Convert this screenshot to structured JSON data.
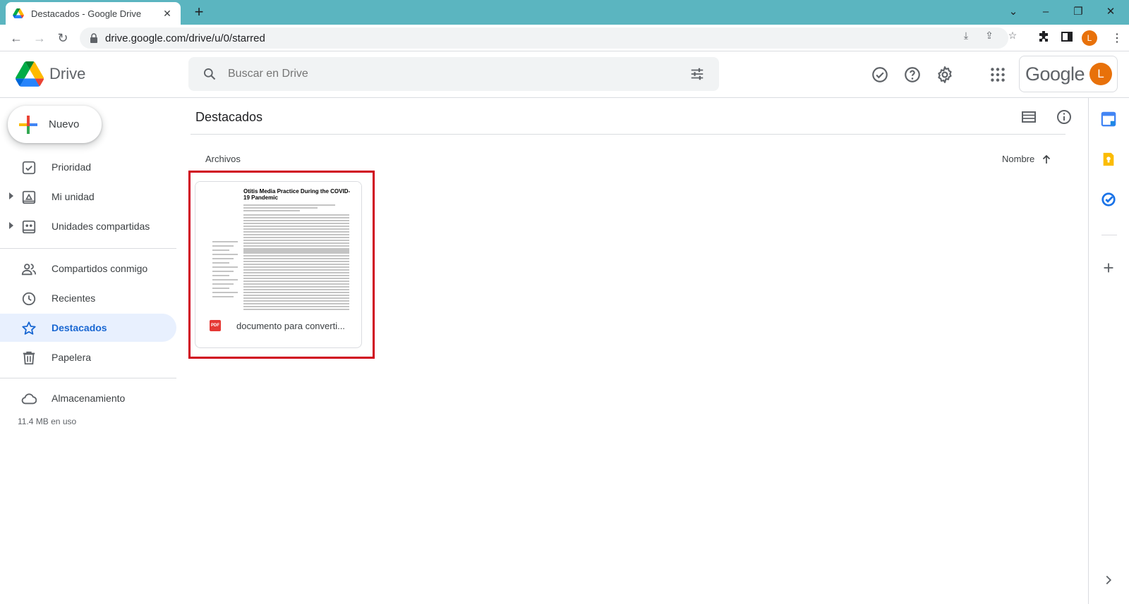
{
  "browser": {
    "tab_title": "Destacados - Google Drive",
    "url": "drive.google.com/drive/u/0/starred",
    "profile_initial": "L"
  },
  "header": {
    "app_name": "Drive",
    "search_placeholder": "Buscar en Drive",
    "google_label": "Google",
    "profile_initial": "L"
  },
  "sidebar": {
    "new_label": "Nuevo",
    "items": [
      {
        "label": "Prioridad",
        "icon": "priority-icon"
      },
      {
        "label": "Mi unidad",
        "icon": "my-drive-icon"
      },
      {
        "label": "Unidades compartidas",
        "icon": "shared-drives-icon"
      },
      {
        "label": "Compartidos conmigo",
        "icon": "shared-with-me-icon"
      },
      {
        "label": "Recientes",
        "icon": "clock-icon"
      },
      {
        "label": "Destacados",
        "icon": "star-icon",
        "active": true
      },
      {
        "label": "Papelera",
        "icon": "trash-icon"
      },
      {
        "label": "Almacenamiento",
        "icon": "cloud-icon"
      }
    ],
    "storage_usage": "11.4 MB en uso"
  },
  "main": {
    "title": "Destacados",
    "section_label": "Archivos",
    "sort_label": "Nombre",
    "files": [
      {
        "name": "documento para converti...",
        "type_badge": "PDF",
        "preview_title": "Otitis Media Practice During the COVID-19 Pandemic"
      }
    ]
  },
  "colors": {
    "accent": "#1967d2",
    "active_bg": "#e8f0fe",
    "tabstrip": "#5bb5c0",
    "highlight": "#d0021b",
    "avatar": "#e8710a"
  }
}
